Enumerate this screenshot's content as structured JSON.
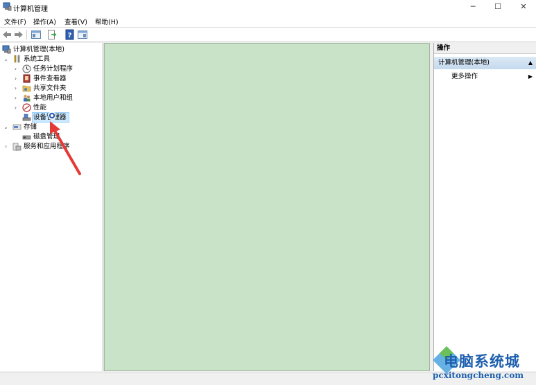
{
  "window": {
    "title": "计算机管理",
    "minimize": "─",
    "maximize": "☐",
    "close": "✕"
  },
  "menu": [
    "文件(F)",
    "操作(A)",
    "查看(V)",
    "帮助(H)"
  ],
  "toolbar": {
    "icons": [
      "back-arrow-icon",
      "forward-arrow-icon",
      "show-hide-console-tree-icon",
      "export-list-icon",
      "help-icon",
      "show-hide-action-pane-icon"
    ]
  },
  "tree": {
    "root": "计算机管理(本地)",
    "system_tools": "系统工具",
    "task_scheduler": "任务计划程序",
    "event_viewer": "事件查看器",
    "shared_folders": "共享文件夹",
    "local_users": "本地用户和组",
    "performance": "性能",
    "device_manager": "设备管理器",
    "storage": "存储",
    "disk_management": "磁盘管理",
    "services_apps": "服务和应用程序"
  },
  "actions": {
    "header": "操作",
    "section": "计算机管理(本地)",
    "more": "更多操作"
  },
  "watermark": {
    "title": "电脑系统城",
    "url": "pcxitongcheng.com"
  },
  "colors": {
    "center_pane": "#c8e3c8",
    "selection": "#cce8ff",
    "annotation_arrow": "#e53935",
    "watermark": "#1d5fae"
  }
}
